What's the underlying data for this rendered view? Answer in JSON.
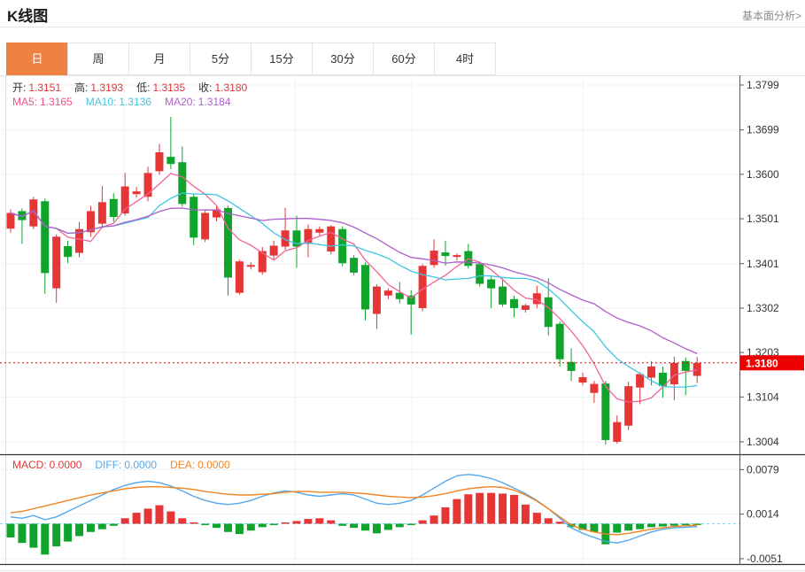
{
  "header": {
    "title": "K线图",
    "analysis_link": "基本面分析>"
  },
  "tabs": {
    "items": [
      "日",
      "周",
      "月",
      "5分",
      "15分",
      "30分",
      "60分",
      "4时"
    ],
    "active_index": 0
  },
  "main_legend": {
    "ohlc": [
      {
        "label": "开:",
        "value": "1.3151"
      },
      {
        "label": "高:",
        "value": "1.3193"
      },
      {
        "label": "低:",
        "value": "1.3135"
      },
      {
        "label": "收:",
        "value": "1.3180"
      }
    ],
    "ma": [
      {
        "label": "MA5:",
        "value": "1.3165",
        "color": "#f0508c"
      },
      {
        "label": "MA10:",
        "value": "1.3136",
        "color": "#3fc6e3"
      },
      {
        "label": "MA20:",
        "value": "1.3184",
        "color": "#ad5fc9"
      }
    ]
  },
  "macd_legend": [
    {
      "label": "MACD:",
      "value": "0.0000",
      "color": "#e53535"
    },
    {
      "label": "DIFF:",
      "value": "0.0000",
      "color": "#54a8ee"
    },
    {
      "label": "DEA:",
      "value": "0.0000",
      "color": "#f08424"
    }
  ],
  "colors": {
    "up": "#e53535",
    "down": "#10a42c",
    "ma5": "#f0649a",
    "ma10": "#3fc6e3",
    "ma20": "#ad5fc9",
    "diff": "#54a8ee",
    "dea": "#f08424",
    "grid": "#edf1f6",
    "border_light": "#e2e2e2",
    "left_border": "#d9dde2",
    "axis": "#555555",
    "axis_text": "#333333",
    "dark_border": "#333333",
    "price_line": "#ee0000",
    "tag_bg": "#ee0000",
    "tag_text": "#ffffff",
    "zero_line": "#8fd2ee",
    "tab_active_bg": "#ef8243",
    "ohlc_label": "#333333",
    "ohlc_value": "#e53535"
  },
  "chart_data": [
    {
      "type": "candlestick",
      "title": "K线图 (daily K-line with MA5/MA10/MA20)",
      "legend_position": "top-left",
      "grid": true,
      "y_axis": {
        "ticks": [
          "1.3799",
          "1.3699",
          "1.3600",
          "1.3501",
          "1.3401",
          "1.3302",
          "1.3203",
          "1.3104",
          "1.3004"
        ],
        "ylim": [
          1.298,
          1.382
        ]
      },
      "current_price": "1.3180",
      "ma_periods": [
        5,
        10,
        20
      ],
      "candles": [
        [
          1.3479,
          1.3522,
          1.347,
          1.3514
        ],
        [
          1.3518,
          1.3524,
          1.3445,
          1.3498
        ],
        [
          1.3484,
          1.355,
          1.3478,
          1.3544
        ],
        [
          1.354,
          1.3546,
          1.3334,
          1.338
        ],
        [
          1.3346,
          1.3466,
          1.3314,
          1.3461
        ],
        [
          1.344,
          1.3452,
          1.3402,
          1.3416
        ],
        [
          1.3425,
          1.3494,
          1.3415,
          1.3478
        ],
        [
          1.3471,
          1.353,
          1.3461,
          1.3518
        ],
        [
          1.349,
          1.3574,
          1.3484,
          1.3538
        ],
        [
          1.3545,
          1.3558,
          1.3494,
          1.3505
        ],
        [
          1.3513,
          1.3603,
          1.3508,
          1.3573
        ],
        [
          1.3556,
          1.3572,
          1.3548,
          1.3562
        ],
        [
          1.355,
          1.3617,
          1.354,
          1.3603
        ],
        [
          1.3607,
          1.3668,
          1.3599,
          1.3649
        ],
        [
          1.3639,
          1.3728,
          1.3612,
          1.3623
        ],
        [
          1.3627,
          1.3662,
          1.3528,
          1.3534
        ],
        [
          1.355,
          1.3557,
          1.3442,
          1.3459
        ],
        [
          1.3455,
          1.3522,
          1.3449,
          1.3514
        ],
        [
          1.3504,
          1.353,
          1.3495,
          1.3522
        ],
        [
          1.3525,
          1.353,
          1.333,
          1.337
        ],
        [
          1.3336,
          1.341,
          1.3332,
          1.3406
        ],
        [
          1.3394,
          1.3404,
          1.3388,
          1.3398
        ],
        [
          1.3382,
          1.3438,
          1.3376,
          1.3429
        ],
        [
          1.3419,
          1.3452,
          1.3408,
          1.3441
        ],
        [
          1.3439,
          1.3525,
          1.3432,
          1.3475
        ],
        [
          1.3475,
          1.3508,
          1.3392,
          1.3439
        ],
        [
          1.3445,
          1.3488,
          1.3415,
          1.3478
        ],
        [
          1.347,
          1.3484,
          1.3464,
          1.3478
        ],
        [
          1.3428,
          1.3487,
          1.3422,
          1.3484
        ],
        [
          1.3478,
          1.3484,
          1.3395,
          1.3402
        ],
        [
          1.3414,
          1.342,
          1.3375,
          1.3381
        ],
        [
          1.3398,
          1.3404,
          1.3275,
          1.3299
        ],
        [
          1.3289,
          1.3355,
          1.3256,
          1.335
        ],
        [
          1.333,
          1.3346,
          1.3322,
          1.3341
        ],
        [
          1.3336,
          1.336,
          1.3312,
          1.3322
        ],
        [
          1.333,
          1.3342,
          1.3243,
          1.331
        ],
        [
          1.3302,
          1.34,
          1.3295,
          1.3396
        ],
        [
          1.3398,
          1.3455,
          1.3392,
          1.343
        ],
        [
          1.3426,
          1.3452,
          1.3396,
          1.3418
        ],
        [
          1.3416,
          1.3424,
          1.3408,
          1.342
        ],
        [
          1.3429,
          1.3445,
          1.339,
          1.3396
        ],
        [
          1.34,
          1.3406,
          1.335,
          1.3356
        ],
        [
          1.3366,
          1.3372,
          1.3302,
          1.3346
        ],
        [
          1.335,
          1.3368,
          1.3305,
          1.331
        ],
        [
          1.3322,
          1.333,
          1.3281,
          1.3302
        ],
        [
          1.3298,
          1.3312,
          1.3292,
          1.3308
        ],
        [
          1.3311,
          1.3352,
          1.3302,
          1.3335
        ],
        [
          1.3326,
          1.3368,
          1.3241,
          1.326
        ],
        [
          1.3267,
          1.3272,
          1.3172,
          1.3188
        ],
        [
          1.3182,
          1.3212,
          1.314,
          1.3162
        ],
        [
          1.3136,
          1.3158,
          1.313,
          1.3148
        ],
        [
          1.3113,
          1.314,
          1.3091,
          1.3133
        ],
        [
          1.3134,
          1.314,
          1.2998,
          1.3008
        ],
        [
          1.3004,
          1.3063,
          1.3,
          1.3048
        ],
        [
          1.304,
          1.3138,
          1.303,
          1.3128
        ],
        [
          1.3125,
          1.3159,
          1.3088,
          1.3155
        ],
        [
          1.3147,
          1.3184,
          1.313,
          1.3172
        ],
        [
          1.3158,
          1.3172,
          1.3102,
          1.3128
        ],
        [
          1.3132,
          1.3194,
          1.3097,
          1.318
        ],
        [
          1.3184,
          1.3192,
          1.3108,
          1.3162
        ],
        [
          1.3151,
          1.3193,
          1.3135,
          1.318
        ]
      ]
    },
    {
      "type": "bar",
      "title": "MACD(DIFF, DEA, histogram)",
      "grid": true,
      "y_axis": {
        "ticks": [
          "0.0079",
          "0.0014",
          "-0.0051"
        ],
        "ylim": [
          -0.006,
          0.009
        ]
      },
      "histogram": [
        -0.002,
        -0.0028,
        -0.0035,
        -0.0045,
        -0.0033,
        -0.0026,
        -0.0018,
        -0.0012,
        -0.0008,
        -0.0003,
        0.0008,
        0.0016,
        0.0022,
        0.0027,
        0.0018,
        0.0008,
        0.0002,
        -0.0002,
        -0.0006,
        -0.0012,
        -0.0015,
        -0.001,
        -0.0005,
        -0.0002,
        0.0002,
        0.0004,
        0.0007,
        0.0008,
        0.0005,
        -0.0003,
        -0.0006,
        -0.001,
        -0.0014,
        -0.0009,
        -0.0005,
        -0.0002,
        0.0005,
        0.0012,
        0.0024,
        0.0036,
        0.0043,
        0.0045,
        0.0045,
        0.0044,
        0.0042,
        0.0028,
        0.0016,
        0.0008,
        0.0003,
        -0.0005,
        -0.0009,
        -0.0012,
        -0.003,
        -0.0013,
        -0.001,
        -0.0008,
        -0.0005,
        -0.0004,
        -0.0003,
        -0.0002,
        -0.0001
      ],
      "series": [
        {
          "name": "DIFF",
          "values": [
            0.001,
            0.0008,
            0.0012,
            0.0006,
            0.001,
            0.0018,
            0.0026,
            0.0034,
            0.0042,
            0.005,
            0.0056,
            0.006,
            0.0062,
            0.006,
            0.0055,
            0.0048,
            0.004,
            0.0034,
            0.003,
            0.0028,
            0.003,
            0.0034,
            0.004,
            0.0045,
            0.0048,
            0.0046,
            0.0042,
            0.004,
            0.0042,
            0.0044,
            0.0042,
            0.0036,
            0.003,
            0.0028,
            0.003,
            0.0034,
            0.0042,
            0.0052,
            0.0062,
            0.007,
            0.0072,
            0.007,
            0.0066,
            0.006,
            0.0052,
            0.0044,
            0.0034,
            0.0022,
            0.0008,
            -0.0006,
            -0.0014,
            -0.002,
            -0.0026,
            -0.0028,
            -0.0024,
            -0.0018,
            -0.0012,
            -0.0008,
            -0.0006,
            -0.0005,
            -0.0004
          ]
        },
        {
          "name": "DEA",
          "values": [
            0.0016,
            0.0018,
            0.0022,
            0.0026,
            0.003,
            0.0034,
            0.0038,
            0.0042,
            0.0045,
            0.0048,
            0.0051,
            0.0053,
            0.0054,
            0.0054,
            0.0053,
            0.0052,
            0.005,
            0.0047,
            0.0045,
            0.0043,
            0.0042,
            0.0042,
            0.0043,
            0.0044,
            0.0046,
            0.0047,
            0.0047,
            0.0046,
            0.0046,
            0.0046,
            0.0045,
            0.0044,
            0.0042,
            0.004,
            0.0039,
            0.0038,
            0.0039,
            0.0041,
            0.0044,
            0.0048,
            0.0051,
            0.0053,
            0.0054,
            0.0053,
            0.0049,
            0.0042,
            0.0033,
            0.0022,
            0.001,
            -0.0002,
            -0.0008,
            -0.0012,
            -0.0015,
            -0.0016,
            -0.0014,
            -0.0011,
            -0.0008,
            -0.0006,
            -0.0004,
            -0.0003,
            -0.0002
          ]
        }
      ]
    }
  ]
}
